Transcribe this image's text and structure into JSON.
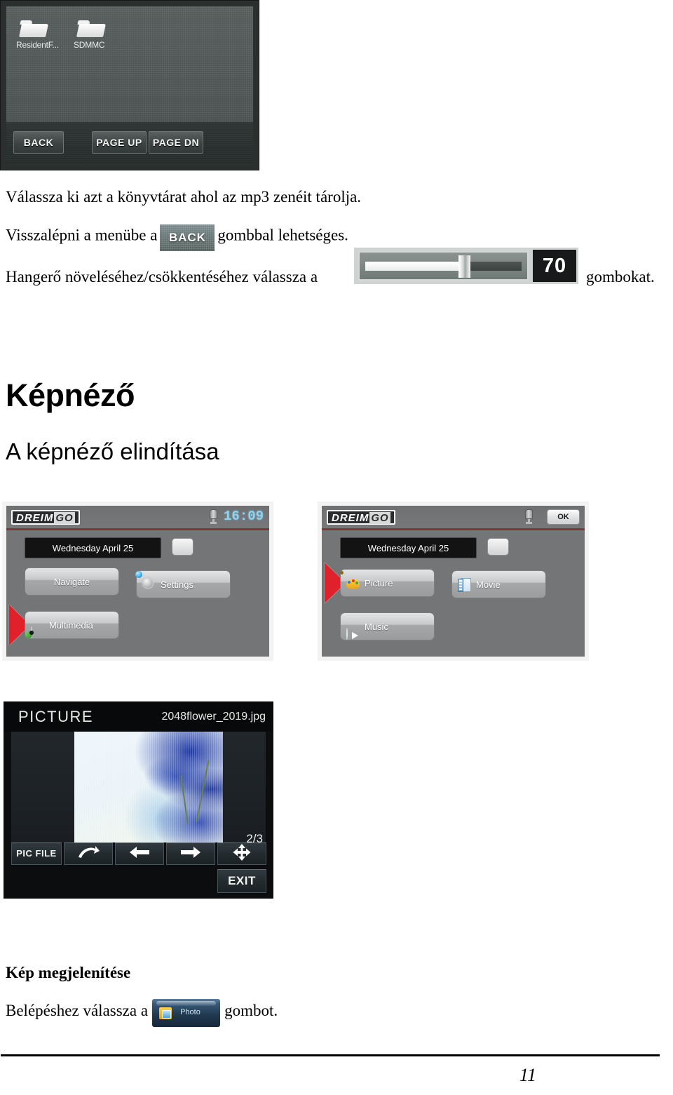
{
  "file_browser": {
    "folders": [
      {
        "label": "ResidentF...",
        "icon": "folder-icon"
      },
      {
        "label": "SDMMC",
        "icon": "folder-icon"
      }
    ],
    "buttons": {
      "back": "BACK",
      "page_up": "PAGE UP",
      "page_down": "PAGE DN"
    }
  },
  "paragraphs": {
    "line1": "Válassza ki azt a könyvtárat ahol az mp3 zenéit tárolja.",
    "line2_before": "Visszalépni a menübe a",
    "line2_button": "BACK",
    "line2_after": "gombbal lehetséges.",
    "line3_before": "Hangerő növeléséhez/csökkentéséhez válassza a",
    "line3_after": "gombokat."
  },
  "volume_widget": {
    "value": "70"
  },
  "headings": {
    "h1": "Képnéző",
    "h2": "A képnéző elindítása",
    "h3": "Kép megjelenítése"
  },
  "devices": [
    {
      "logo_main": "DREIM",
      "logo_suffix": "GO",
      "clock": "16:09",
      "usb_icon": "usb-icon",
      "date": "Wednesday April 25",
      "flag": "uk-flag-icon",
      "menu_items": [
        {
          "label": "Navigate",
          "icon": "none"
        },
        {
          "label": "Settings",
          "icon": "gear-icon"
        },
        {
          "label": "Multimedia",
          "icon": "disc-icon"
        }
      ],
      "selected": "Multimedia"
    },
    {
      "logo_main": "DREIM",
      "logo_suffix": "GO",
      "ok_label": "OK",
      "usb_icon": "usb-icon",
      "date": "Wednesday April 25",
      "flag": "uk-flag-icon",
      "menu_items": [
        {
          "label": "Picture",
          "icon": "palette-icon"
        },
        {
          "label": "Movie",
          "icon": "film-icon"
        },
        {
          "label": "Music",
          "icon": "music-icon"
        }
      ],
      "selected": "Picture"
    }
  ],
  "picture_viewer": {
    "title": "PICTURE",
    "filename": "2048flower_2019.jpg",
    "counter": "2/3",
    "buttons": {
      "pic_file": "PIC FILE",
      "rotate": "rotate-icon",
      "previous": "arrow-left-icon",
      "next": "arrow-right-icon",
      "pan": "move-icon",
      "exit": "EXIT"
    }
  },
  "bottom_text": {
    "before": "Belépéshez válassza a",
    "button_label": "Photo",
    "after": "gombot."
  },
  "footer": {
    "page_number": "11"
  },
  "colors": {
    "accent_red": "#e0202a",
    "device_bg": "#747577",
    "clock_blue": "#8fd3f0"
  }
}
